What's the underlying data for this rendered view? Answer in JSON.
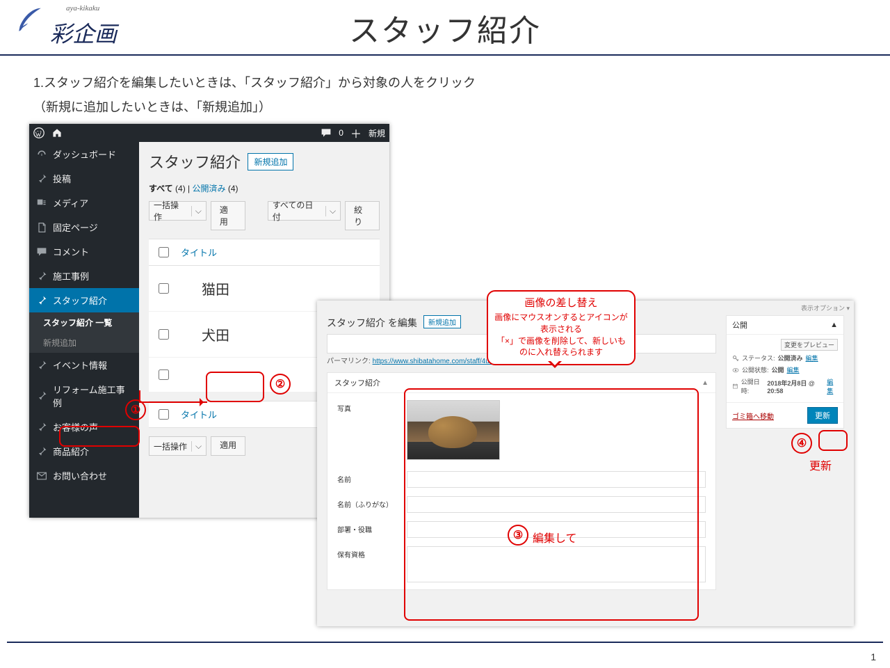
{
  "slide": {
    "brand": "彩企画",
    "brand_sub": "aya-kikaku",
    "title": "スタッフ紹介",
    "page_number": "1",
    "line1": "1.スタッフ紹介を編集したいときは、「スタッフ紹介」から対象の人をクリック",
    "line2": "（新規に追加したいときは、「新規追加」）"
  },
  "wp": {
    "topbar": {
      "comments": "0",
      "add_new": "新規"
    },
    "sidebar": {
      "dashboard": "ダッシュボード",
      "posts": "投稿",
      "media": "メディア",
      "pages": "固定ページ",
      "comments": "コメント",
      "works": "施工事例",
      "staff": "スタッフ紹介",
      "staff_list": "スタッフ紹介 一覧",
      "staff_new": "新規追加",
      "events": "イベント情報",
      "reform": "リフォーム施工事例",
      "voices": "お客様の声",
      "products": "商品紹介",
      "contact": "お問い合わせ"
    },
    "list": {
      "heading": "スタッフ紹介",
      "add_new": "新規追加",
      "filter_all": "すべて",
      "filter_all_count": "(4)",
      "filter_sep": " | ",
      "filter_pub": "公開済み",
      "filter_pub_count": "(4)",
      "bulk": "一括操作",
      "apply": "適用",
      "all_dates": "すべての日付",
      "narrow": "絞り",
      "col_title": "タイトル",
      "rows": [
        "猫田",
        "犬田",
        ""
      ],
      "bulk2": "一括操作",
      "apply2": "適用"
    }
  },
  "edit": {
    "screen_options": "表示オプション ▾",
    "heading": "スタッフ紹介 を編集",
    "add_new": "新規追加",
    "permalink_label": "パーマリンク:",
    "permalink_url": "https://www.shibatahome.com/staff/4u/a/",
    "metabox_title": "スタッフ紹介",
    "fields": {
      "photo": "写真",
      "name": "名前",
      "furigana": "名前（ふりがな）",
      "dept": "部署・役職",
      "qual": "保有資格"
    },
    "publish": {
      "title": "公開",
      "preview": "変更をプレビュー",
      "status_label": "ステータス:",
      "status_value": "公開済み",
      "edit": "編集",
      "visibility_label": "公開状態:",
      "visibility_value": "公開",
      "date_label": "公開日時:",
      "date_value": "2018年2月8日 @ 20:58",
      "trash": "ゴミ箱へ移動",
      "update": "更新"
    }
  },
  "annotations": {
    "n1": "①",
    "n2": "②",
    "n3": "③",
    "n4": "④",
    "edit_label": "編集して",
    "update_label": "更新",
    "callout_title": "画像の差し替え",
    "callout_body1": "画像にマウスオンするとアイコンが表示される",
    "callout_body2": "「×」で画像を削除して、新しいものに入れ替えられます"
  }
}
